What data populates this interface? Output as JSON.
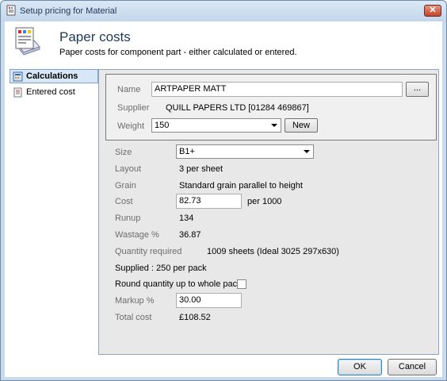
{
  "window": {
    "title": "Setup pricing for Material",
    "close_label": "✕"
  },
  "header": {
    "title": "Paper costs",
    "subtitle": "Paper costs for component part - either calculated or entered."
  },
  "nav": {
    "items": [
      {
        "label": "Calculations",
        "icon": "calculator-icon",
        "active": true
      },
      {
        "label": "Entered cost",
        "icon": "document-icon",
        "active": false
      }
    ]
  },
  "material": {
    "name_label": "Name",
    "name_value": "ARTPAPER MATT",
    "browse_label": "...",
    "supplier_label": "Supplier",
    "supplier_value": "QUILL PAPERS LTD [01284 469867]",
    "weight_label": "Weight",
    "weight_value": "150",
    "new_label": "New"
  },
  "calc": {
    "size_label": "Size",
    "size_value": "B1+",
    "layout_label": "Layout",
    "layout_value": "3 per sheet",
    "grain_label": "Grain",
    "grain_value": "Standard grain parallel to height",
    "cost_label": "Cost",
    "cost_value": "82.73",
    "cost_unit": "per 1000",
    "runup_label": "Runup",
    "runup_value": "134",
    "wastage_label": "Wastage %",
    "wastage_value": "36.87",
    "quantity_label": "Quantity required",
    "quantity_value": "1009 sheets (Ideal 3025 297x630)",
    "supplied_text": "Supplied : 250 per pack",
    "round_label": "Round quantity up to whole packs",
    "round_checked": false,
    "markup_label": "Markup %",
    "markup_value": "30.00",
    "total_label": "Total cost",
    "total_value": "£108.52"
  },
  "footer": {
    "ok_label": "OK",
    "cancel_label": "Cancel"
  }
}
